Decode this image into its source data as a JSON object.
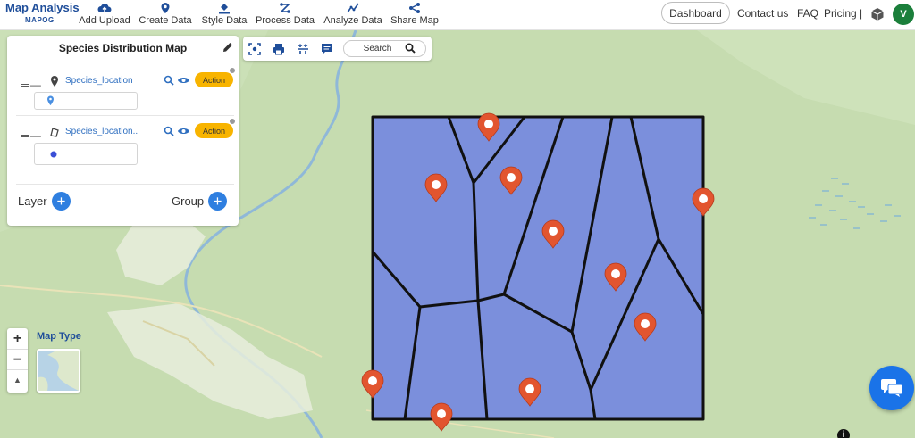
{
  "brand": {
    "name": "Map Analysis",
    "sub": "MAPOG"
  },
  "nav": [
    {
      "label": "Add Upload",
      "icon": "cloud-upload-icon"
    },
    {
      "label": "Create Data",
      "icon": "location-pin-icon"
    },
    {
      "label": "Style Data",
      "icon": "paint-bucket-icon"
    },
    {
      "label": "Process Data",
      "icon": "process-icon"
    },
    {
      "label": "Analyze Data",
      "icon": "analyze-icon"
    },
    {
      "label": "Share Map",
      "icon": "share-icon"
    }
  ],
  "header_right": {
    "dashboard": "Dashboard",
    "contact": "Contact us",
    "faq": "FAQ",
    "pricing": "Pricing |",
    "avatar": "V"
  },
  "panel": {
    "title": "Species Distribution Map",
    "layers": [
      {
        "name": "Species_location",
        "geometry_icon": "point-icon",
        "action": "Action",
        "style_icon": "map-pin-icon",
        "style_color": "#4a90e2"
      },
      {
        "name": "Species_location...",
        "geometry_icon": "polygon-icon",
        "action": "Action",
        "style_icon": "dot-icon",
        "style_color": "#3a4fd6"
      }
    ],
    "layer_label": "Layer",
    "group_label": "Group"
  },
  "toolbar": {
    "search": "Search"
  },
  "zoom": {
    "in": "+",
    "out": "−",
    "reset": "▲"
  },
  "map_type": {
    "label": "Map Type"
  },
  "info": "i",
  "colors": {
    "brand": "#1f4e9a",
    "accent": "#2f7fe0",
    "action": "#f8b400",
    "polygon_fill": "#7b8fdc",
    "marker": "#e2552f",
    "map_bg": "#c6dcb0",
    "avatar": "#1b7f3b"
  }
}
